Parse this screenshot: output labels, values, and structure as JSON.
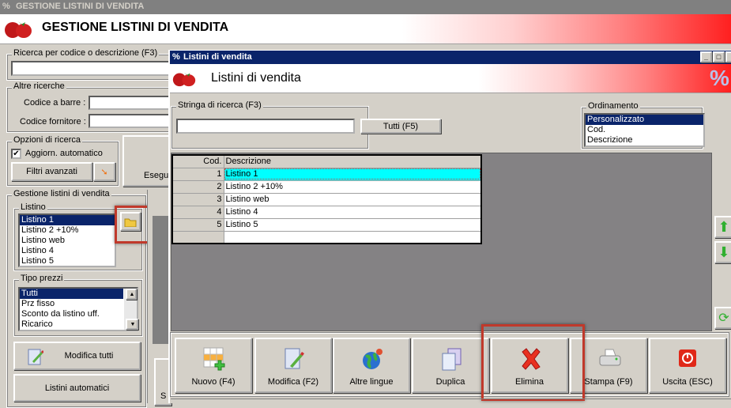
{
  "main_window": {
    "title": "GESTIONE LISTINI DI VENDITA",
    "header_title": "GESTIONE LISTINI DI VENDITA"
  },
  "left": {
    "search_group": "Ricerca per codice o descrizione (F3)",
    "search_value": "",
    "other_group": "Altre ricerche",
    "barcode_label": "Codice a barre :",
    "supplier_label": "Codice fornitore :",
    "options_group": "Opzioni di ricerca",
    "auto_update_label": "Aggiorn. automatico",
    "auto_update_checked": true,
    "advanced_filters": "Filtri avanzati",
    "execute_label": "Esegu",
    "manage_group": "Gestione listini di vendita",
    "listino_group": "Listino",
    "listini": [
      "Listino 1",
      "Listino 2 +10%",
      "Listino web",
      "Listino 4",
      "Listino 5"
    ],
    "price_group": "Tipo prezzi",
    "price_types": [
      "Tutti",
      "Prz fisso",
      "Sconto da listino uff.",
      "Ricarico"
    ],
    "edit_all": "Modifica tutti",
    "auto_lists": "Listini automatici",
    "partial_btn": "S"
  },
  "dialog": {
    "title": "Listini di vendita",
    "header_title": "Listini di vendita",
    "search_group": "Stringa di ricerca (F3)",
    "search_value": "",
    "all_button": "Tutti (F5)",
    "order_group": "Ordinamento",
    "order_options": [
      "Personalizzato",
      "Cod.",
      "Descrizione"
    ],
    "order_selected": "Personalizzato",
    "table": {
      "headers": [
        "Cod.",
        "Descrizione"
      ],
      "rows": [
        [
          "1",
          "Listino 1"
        ],
        [
          "2",
          "Listino 2 +10%"
        ],
        [
          "3",
          "Listino web"
        ],
        [
          "4",
          "Listino 4"
        ],
        [
          "5",
          "Listino 5"
        ]
      ],
      "selected_row": 0
    },
    "toolbar": [
      "Nuovo (F4)",
      "Modifica (F2)",
      "Altre lingue",
      "Duplica",
      "Elimina",
      "Stampa (F9)",
      "Uscita (ESC)"
    ]
  },
  "colors": {
    "selection": "#0a246a",
    "row_highlight": "#00ffff",
    "annotation": "#c0392b"
  }
}
